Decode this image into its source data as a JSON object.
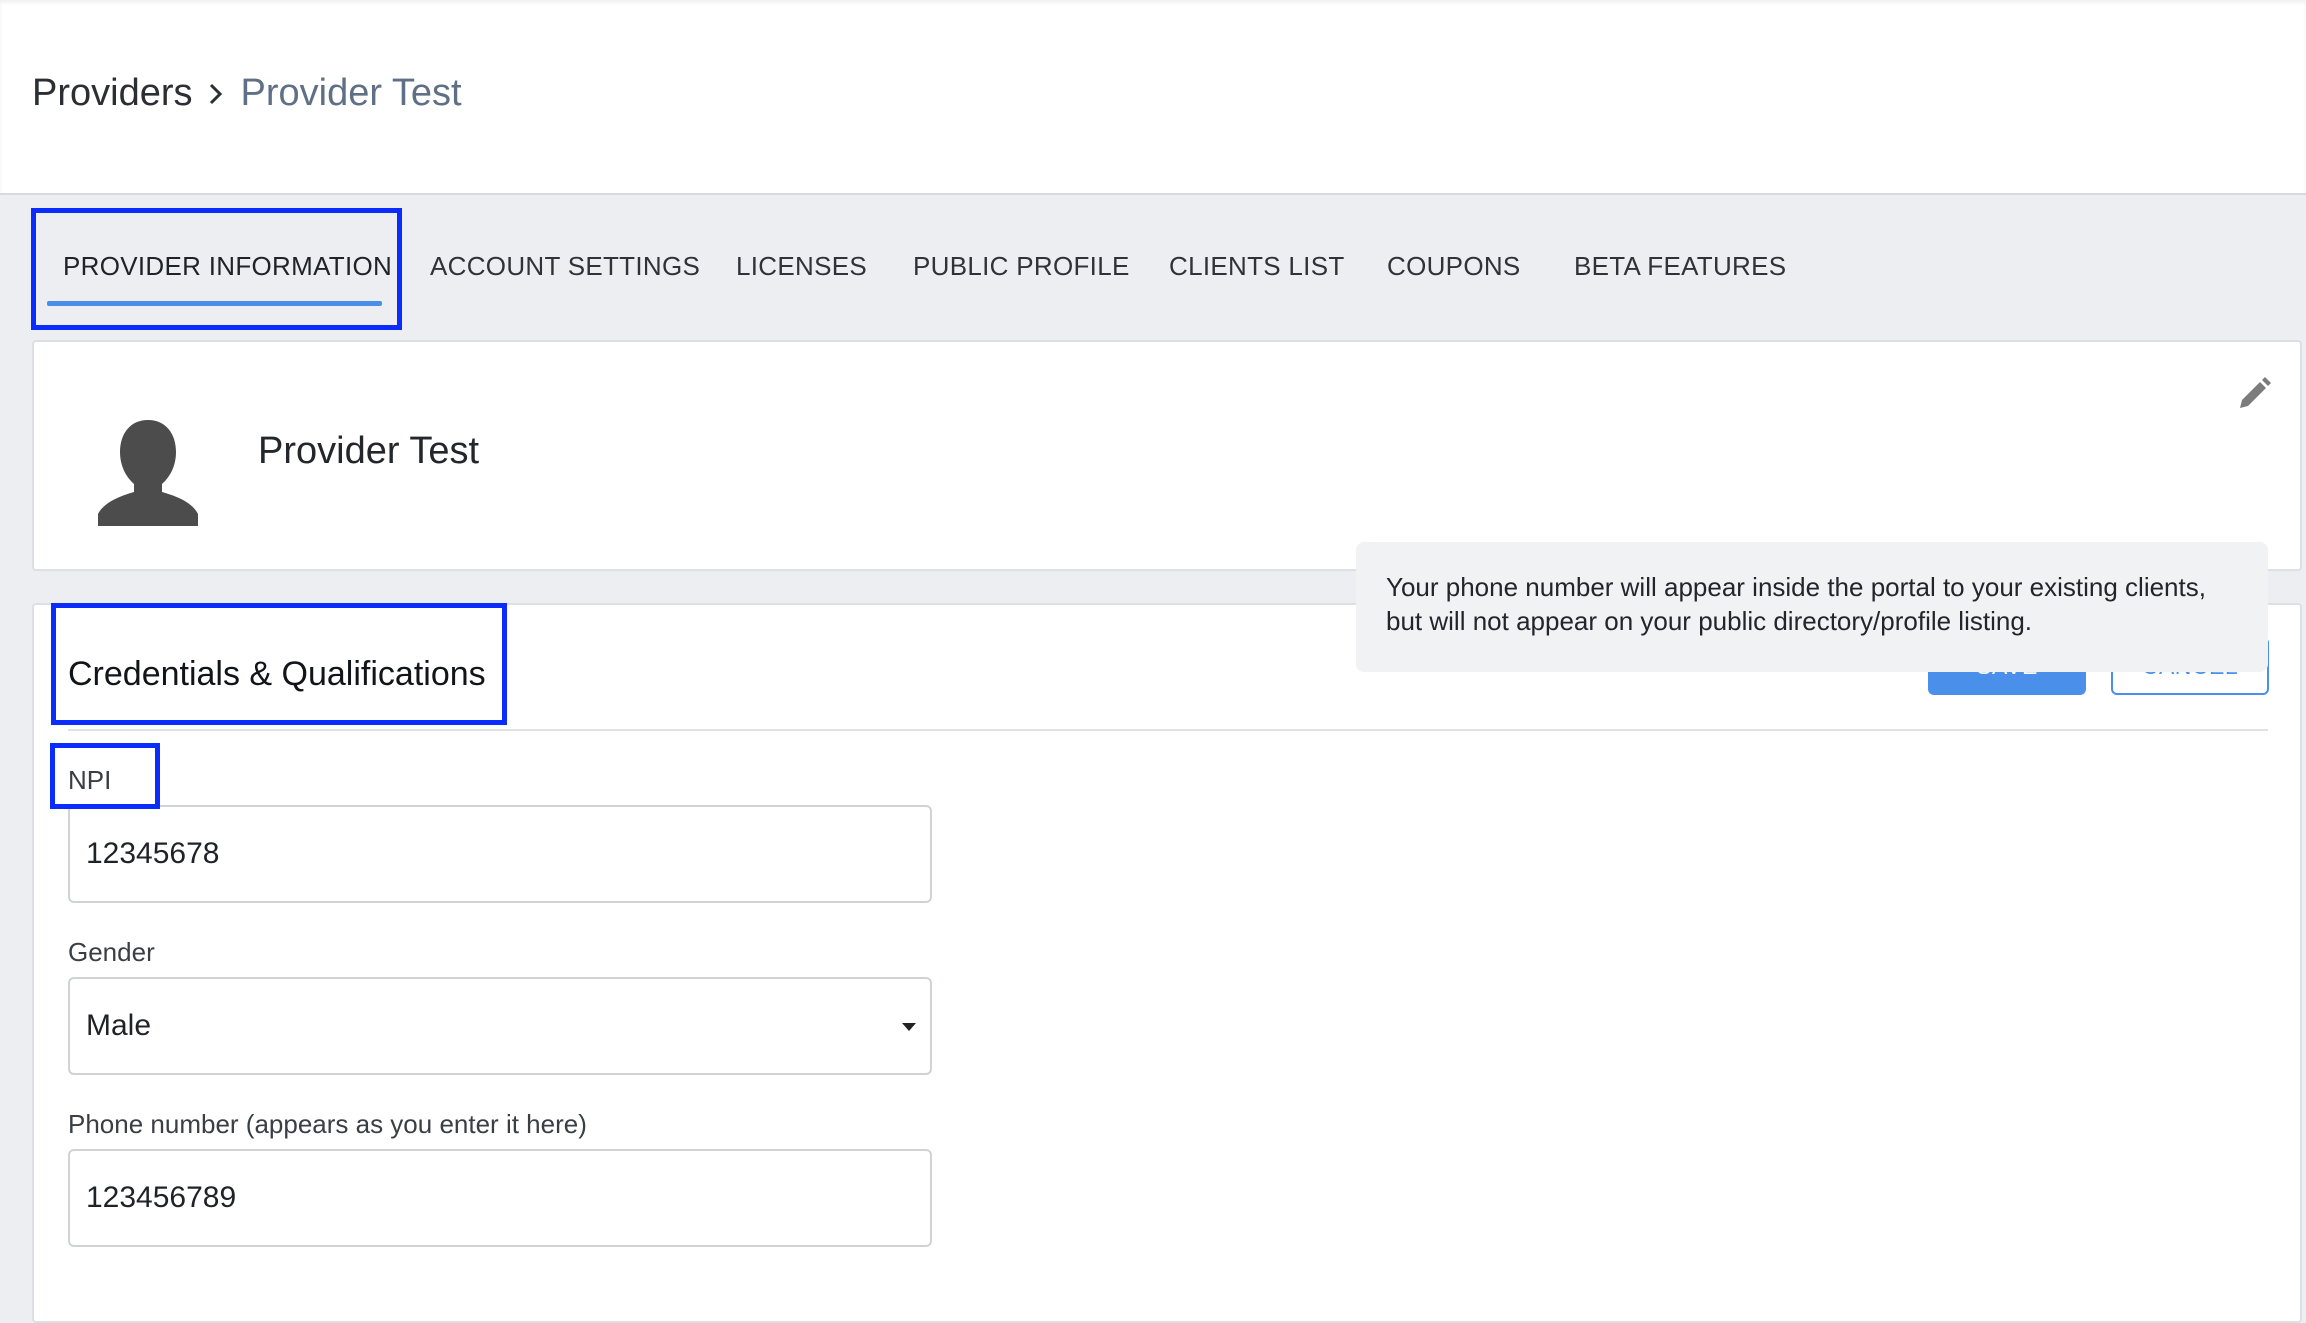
{
  "breadcrumb": {
    "root": "Providers",
    "current": "Provider Test"
  },
  "tabs": [
    {
      "label": "PROVIDER INFORMATION",
      "active": true
    },
    {
      "label": "ACCOUNT SETTINGS",
      "active": false
    },
    {
      "label": "LICENSES",
      "active": false
    },
    {
      "label": "PUBLIC PROFILE",
      "active": false
    },
    {
      "label": "CLIENTS LIST",
      "active": false
    },
    {
      "label": "COUPONS",
      "active": false
    },
    {
      "label": "BETA FEATURES",
      "active": false
    }
  ],
  "profile": {
    "name": "Provider Test",
    "avatar_icon": "person-silhouette-icon",
    "edit_icon": "pencil-icon"
  },
  "credentials": {
    "title": "Credentials & Qualifications",
    "save_label": "SAVE",
    "cancel_label": "CANCEL",
    "npi": {
      "label": "NPI",
      "value": "12345678"
    },
    "gender": {
      "label": "Gender",
      "value": "Male"
    },
    "phone": {
      "label": "Phone number (appears as you enter it here)",
      "value": "123456789"
    },
    "phone_note": "Your phone number will appear inside the portal to your existing clients, but will not appear on your public directory/profile listing."
  },
  "colors": {
    "accent": "#4a90ea",
    "highlight_box": "#0b2cff"
  }
}
